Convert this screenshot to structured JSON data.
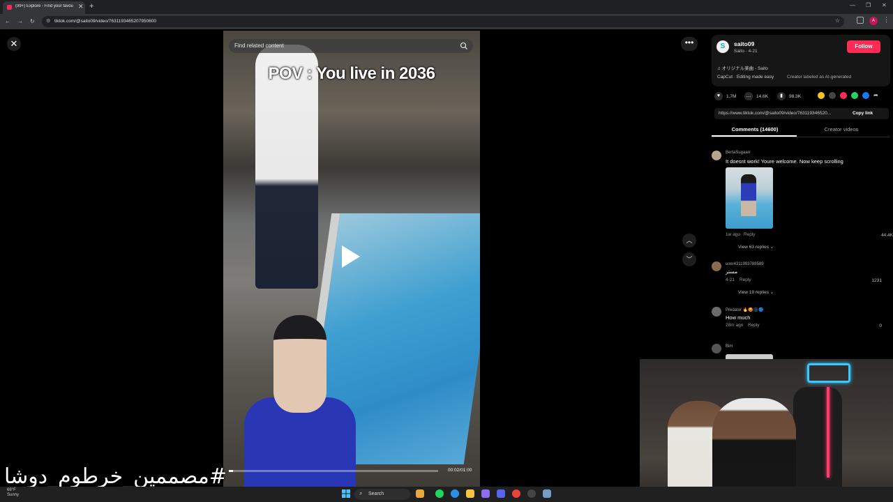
{
  "browser": {
    "tab_title": "(99+) Explore - Find your favou",
    "new_tab": "+",
    "url": "tiktok.com/@saito09/video/7631193465207950600",
    "window_minimize": "—",
    "window_restore": "❐",
    "window_close": "✕"
  },
  "video": {
    "search_placeholder": "Find related content",
    "caption": "POV : You live in 2036",
    "progress": 0.02,
    "time": "00:02/01:00"
  },
  "creator": {
    "avatar_letter": "S",
    "username": "saito09",
    "subline": "Saito · 4-21",
    "follow_label": "Follow",
    "music": "♫ オリジナル楽曲 - Saito",
    "capcut": "CapCut · Editing made easy",
    "ai_label": "Creator labeled as AI-generated"
  },
  "stats": {
    "likes": "1.7M",
    "comments": "14.6K",
    "saves": "98.3K"
  },
  "share": {
    "link": "https://www.tiktok.com/@saito09/video/763119346520...",
    "copy_label": "Copy link"
  },
  "tabs": {
    "comments": "Comments (14600)",
    "creator_videos": "Creator videos"
  },
  "comments": [
    {
      "user": "BertaSugaarr",
      "text": "It doesnt work! Youre welcome. Now keep scrolling",
      "time": "1w ago",
      "reply": "Reply",
      "likes": "44.4K",
      "view_replies": "View 63 replies ⌄"
    },
    {
      "user": "user4311993788589",
      "text": "مستر",
      "time": "4-21",
      "reply": "Reply",
      "likes": "1231",
      "view_replies": "View 19 replies ⌄"
    },
    {
      "user": "Predator 🔥😡🌑🔵",
      "text": "How much",
      "time": "28m ago",
      "reply": "Reply",
      "likes": "0"
    },
    {
      "user": "Bim"
    }
  ],
  "overlay": {
    "hashtag": "#مصممين_خرطوم_دوشا"
  },
  "taskbar": {
    "weather_temp": "68°F",
    "weather_desc": "Sunny",
    "search_label": "Search"
  },
  "colors": {
    "accent": "#fe2c55",
    "background": "#000000"
  }
}
